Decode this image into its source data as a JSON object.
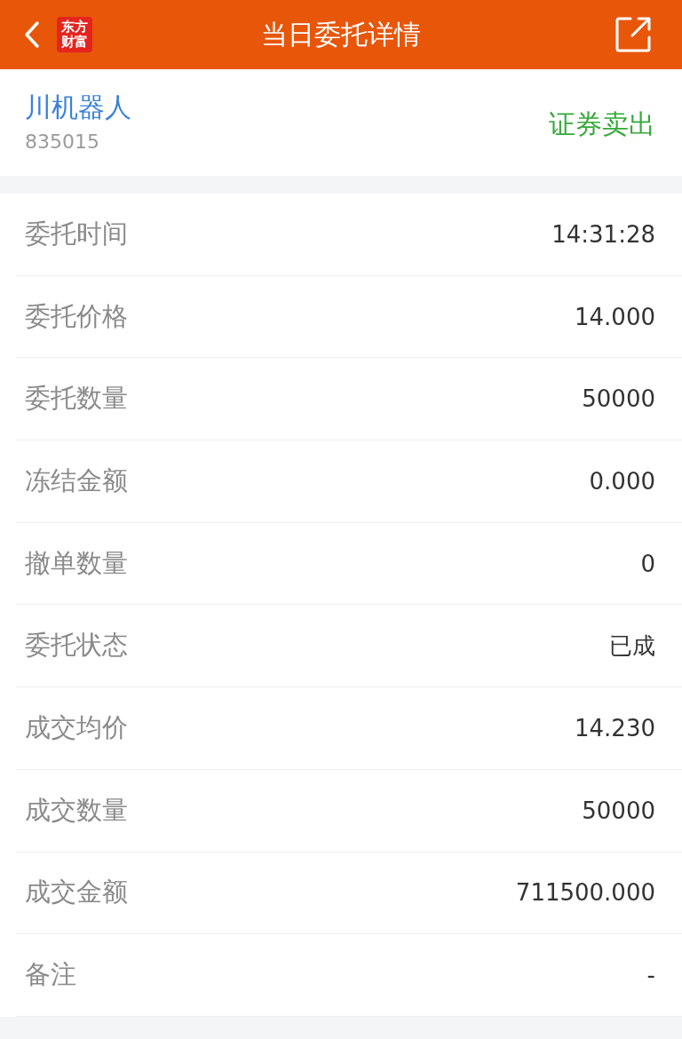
{
  "header": {
    "title": "当日委托详情",
    "logo": {
      "line_1": "东方",
      "line_2": "财富"
    }
  },
  "stock": {
    "name": "川机器人",
    "code": "835015",
    "order_type": "证券卖出"
  },
  "details": [
    {
      "label": "委托时间",
      "value": "14:31:28"
    },
    {
      "label": "委托价格",
      "value": "14.000"
    },
    {
      "label": "委托数量",
      "value": "50000"
    },
    {
      "label": "冻结金额",
      "value": "0.000"
    },
    {
      "label": "撤单数量",
      "value": "0"
    },
    {
      "label": "委托状态",
      "value": "已成"
    },
    {
      "label": "成交均价",
      "value": "14.230"
    },
    {
      "label": "成交数量",
      "value": "50000"
    },
    {
      "label": "成交金额",
      "value": "711500.000"
    },
    {
      "label": "备注",
      "value": "-"
    }
  ]
}
